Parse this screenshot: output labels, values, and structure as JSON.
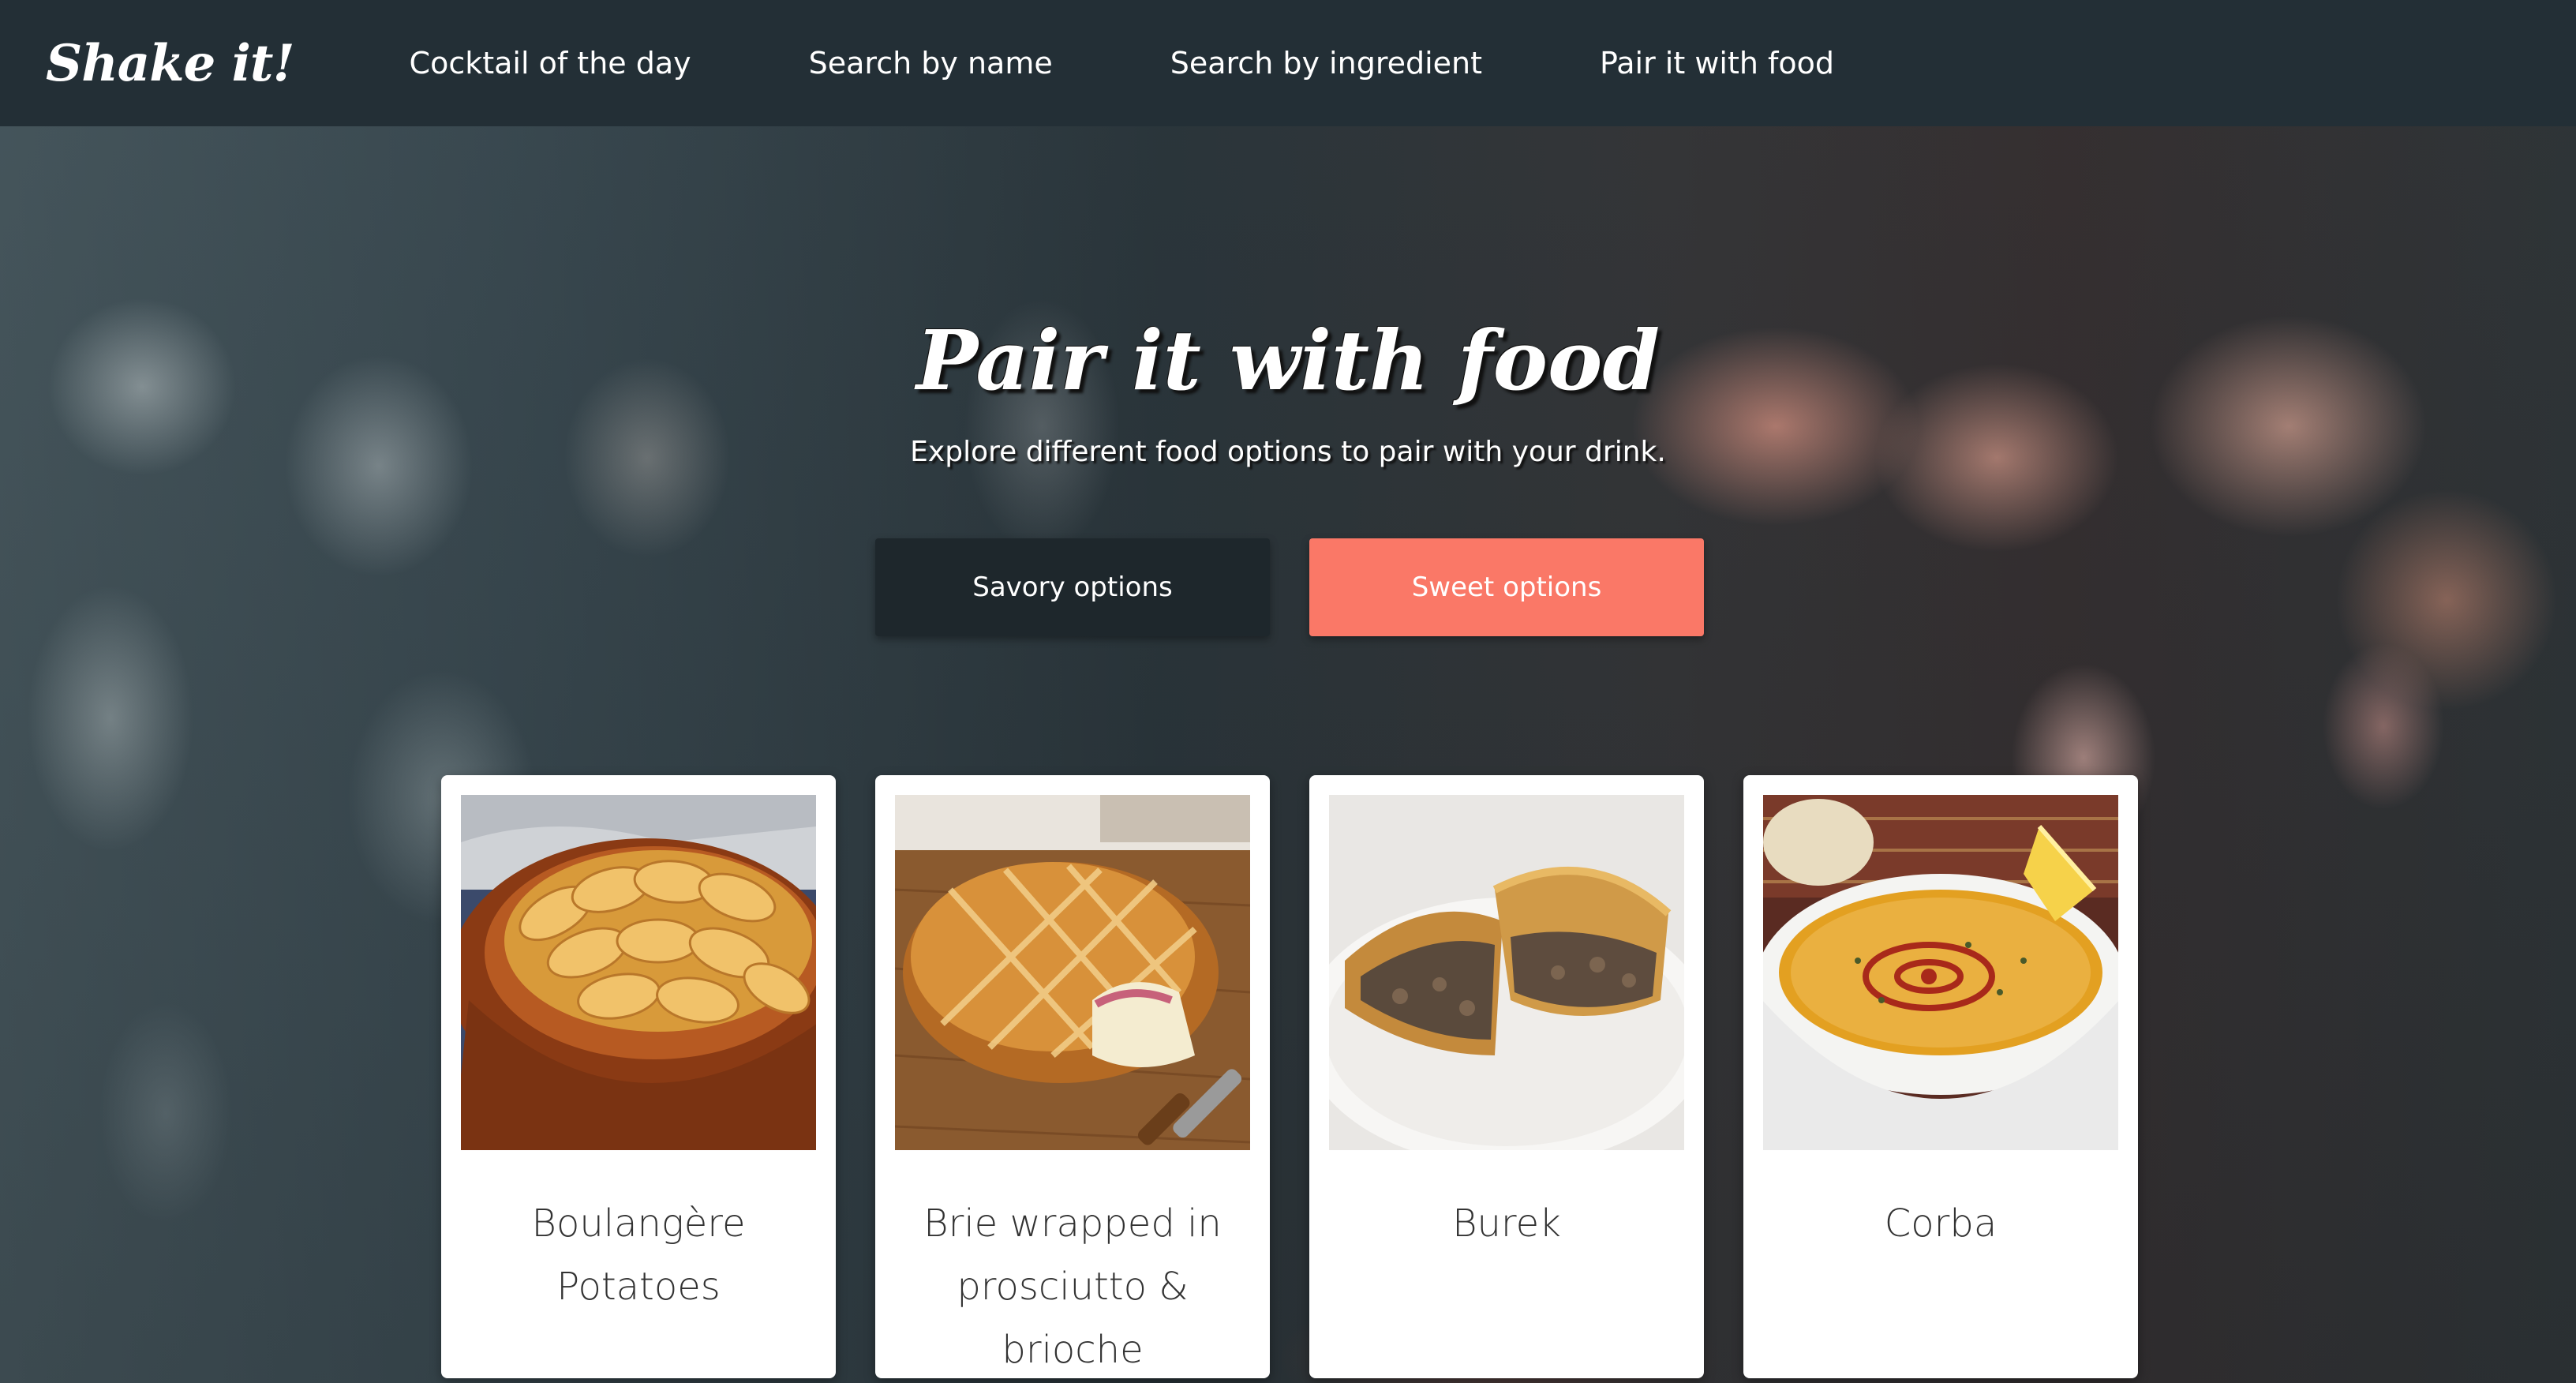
{
  "nav": {
    "brand": "Shake it!",
    "links": [
      "Cocktail of the day",
      "Search by name",
      "Search by ingredient",
      "Pair it with food"
    ]
  },
  "hero": {
    "title": "Pair it with food",
    "subtitle": "Explore different food options to pair with your drink."
  },
  "buttons": {
    "savory": "Savory options",
    "sweet": "Sweet options"
  },
  "colors": {
    "navbar": "#232f36",
    "savory_button": "#1e272c",
    "sweet_button": "#fa7867",
    "card": "#ffffff"
  },
  "cards": [
    {
      "name": "Boulangère Potatoes",
      "image": "gratin-potatoes-dish"
    },
    {
      "name": "Brie wrapped in prosciutto & brioche",
      "image": "brie-brioche-loaf"
    },
    {
      "name": "Burek",
      "image": "burek-pastry-plate"
    },
    {
      "name": "Corba",
      "image": "lentil-soup-bowl"
    }
  ]
}
